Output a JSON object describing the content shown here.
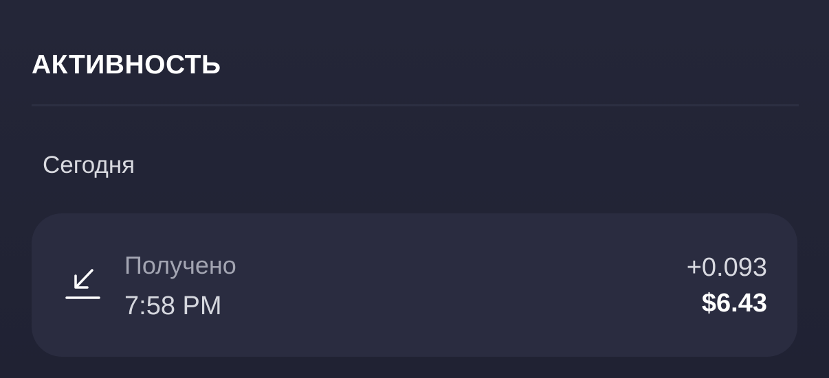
{
  "header": {
    "title": "АКТИВНОСТЬ"
  },
  "section": {
    "label": "Сегодня"
  },
  "transactions": [
    {
      "type": "Получено",
      "time": "7:58 PM",
      "amount": "+0.093",
      "fiat": "$6.43",
      "icon": "receive-arrow-icon"
    }
  ]
}
